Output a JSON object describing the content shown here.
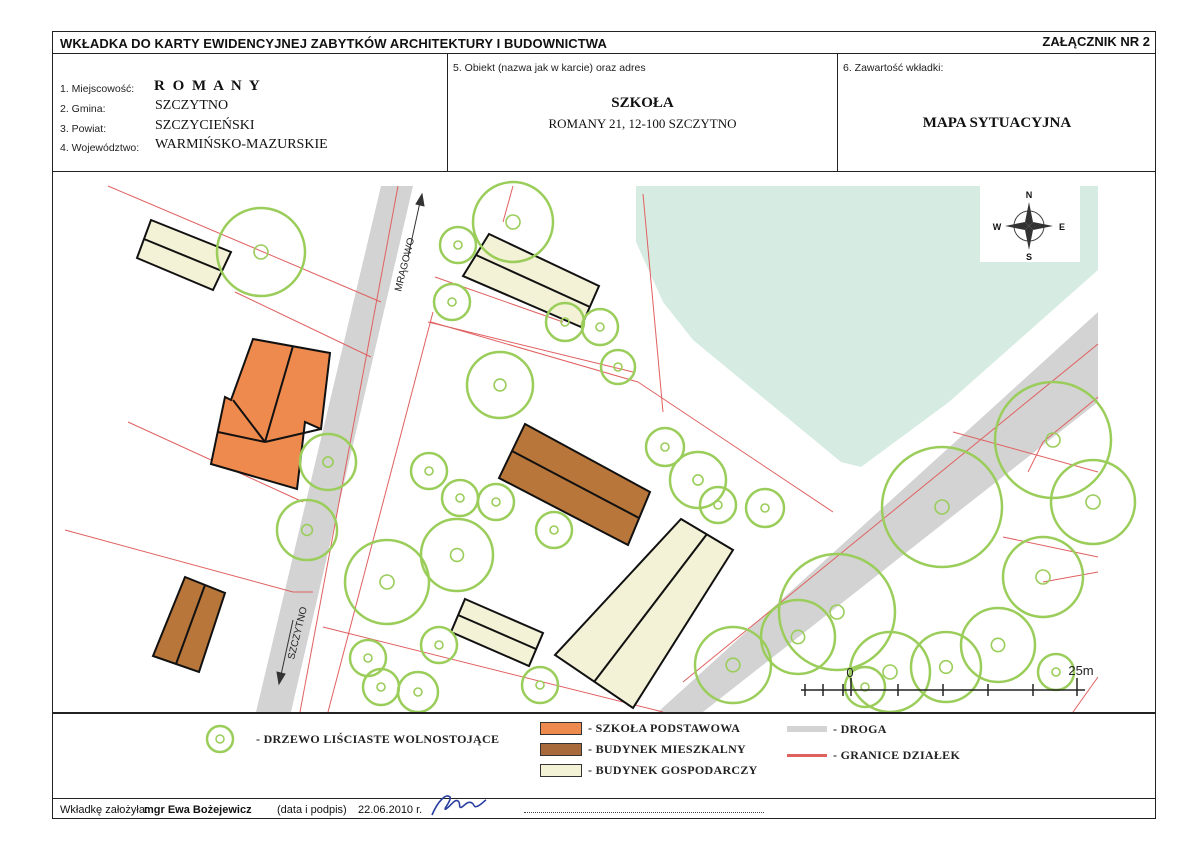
{
  "header": {
    "title": "WKŁADKA DO KARTY EWIDENCYJNEJ ZABYTKÓW ARCHITEKTURY I BUDOWNICTWA",
    "annex": "ZAŁĄCZNIK NR 2"
  },
  "fields": {
    "miejscowosc_label": "1. Miejscowość:",
    "miejscowosc_value": "R O M A N Y",
    "gmina_label": "2. Gmina:",
    "gmina_value": "SZCZYTNO",
    "powiat_label": "3. Powiat:",
    "powiat_value": "SZCZYCIEŃSKI",
    "wojewodztwo_label": "4. Województwo:",
    "wojewodztwo_value": "WARMIŃSKO-MAZURSKIE",
    "obiekt_label": "5. Obiekt (nazwa jak w karcie) oraz adres",
    "obiekt_name": "SZKOŁA",
    "obiekt_address": "ROMANY 21, 12-100 SZCZYTNO",
    "zawartosc_label": "6. Zawartość wkładki:",
    "zawartosc_value": "MAPA SYTUACYJNA"
  },
  "map": {
    "road_label_north": "MRĄGOWO",
    "road_label_south": "SZCZYTNO",
    "compass": {
      "n": "N",
      "s": "S",
      "e": "E",
      "w": "W"
    },
    "scale": {
      "start": "0",
      "end": "25m"
    },
    "colors": {
      "school": "#ef8a4f",
      "residential": "#b8763a",
      "farm": "#f3f1d6",
      "road": "#d3d3d3",
      "boundary": "#e06060",
      "tree": "#9acd5a",
      "green_area": "#d6ece3"
    }
  },
  "legend": {
    "tree": "- DRZEWO LIŚCIASTE WOLNOSTOJĄCE",
    "school": "- SZKOŁA PODSTAWOWA",
    "residential": "- BUDYNEK MIESZKALNY",
    "farm": "- BUDYNEK GOSPODARCZY",
    "road": "- DROGA",
    "boundary": "- GRANICE DZIAŁEK"
  },
  "footer": {
    "label": "Wkładkę założyła:",
    "author": "mgr Ewa Bożejewicz",
    "sign_note": "(data i podpis)",
    "date": "22.06.2010 r."
  }
}
